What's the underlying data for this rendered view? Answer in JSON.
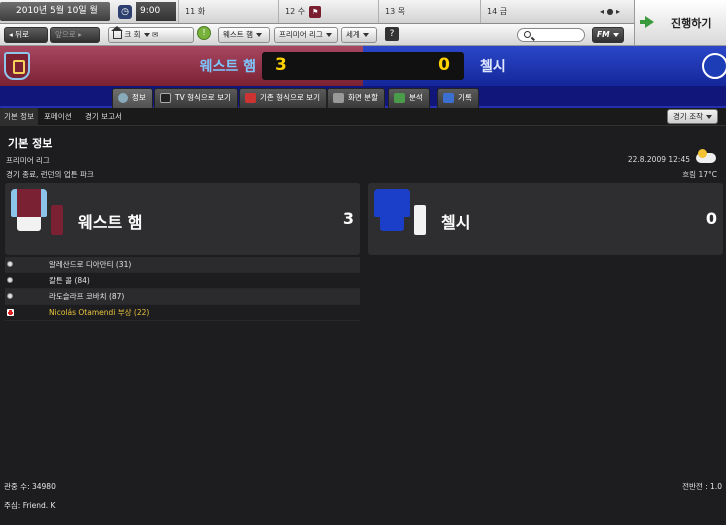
{
  "calendar": {
    "date": "2010년 5월 10일 월",
    "time": "9:00",
    "days": [
      "11 화",
      "12 수",
      "13 목",
      "14 금"
    ],
    "nav_arrows": "◂ ● ▸"
  },
  "continue_label": "진행하기",
  "toolbar": {
    "back": "뒤로",
    "forward": "앞으로",
    "club": "크 회",
    "team": "웨스트 햄",
    "league": "프리미어 리그",
    "world": "세계",
    "help": "?",
    "fm": "FM"
  },
  "match": {
    "home_team": "웨스트 햄",
    "away_team": "첼시",
    "home_score": "3",
    "away_score": "0"
  },
  "tabs": [
    "정보",
    "TV 형식으로 보기",
    "기존 형식으로 보기",
    "화면 분할",
    "분석",
    "기록"
  ],
  "subnav": {
    "items": [
      "기본 정보",
      "포메이션",
      "경기 보고서"
    ],
    "control": "경기 조작"
  },
  "info": {
    "title": "기본 정보",
    "competition": "프리미어 리그",
    "venue": "경기 종료, 런던의 업튼 파크",
    "datetime": "22.8.2009 12:45",
    "weather": "흐림 17°C"
  },
  "events": [
    {
      "text": "알레산드로 디아만티 (31)",
      "type": "goal"
    },
    {
      "text": "칼튼 콜 (84)",
      "type": "goal"
    },
    {
      "text": "라도슬라프 코바치 (87)",
      "type": "goal"
    },
    {
      "text": "Nicolás Otamendi 부상 (22)",
      "type": "injury"
    }
  ],
  "footer": {
    "attendance": "관중 수: 34980",
    "referee": "주심: Friend. K",
    "halftime": "전반전 : 1.0"
  },
  "colors": {
    "home": "#7a2234",
    "away": "#14279a",
    "score": "#ffd200"
  }
}
